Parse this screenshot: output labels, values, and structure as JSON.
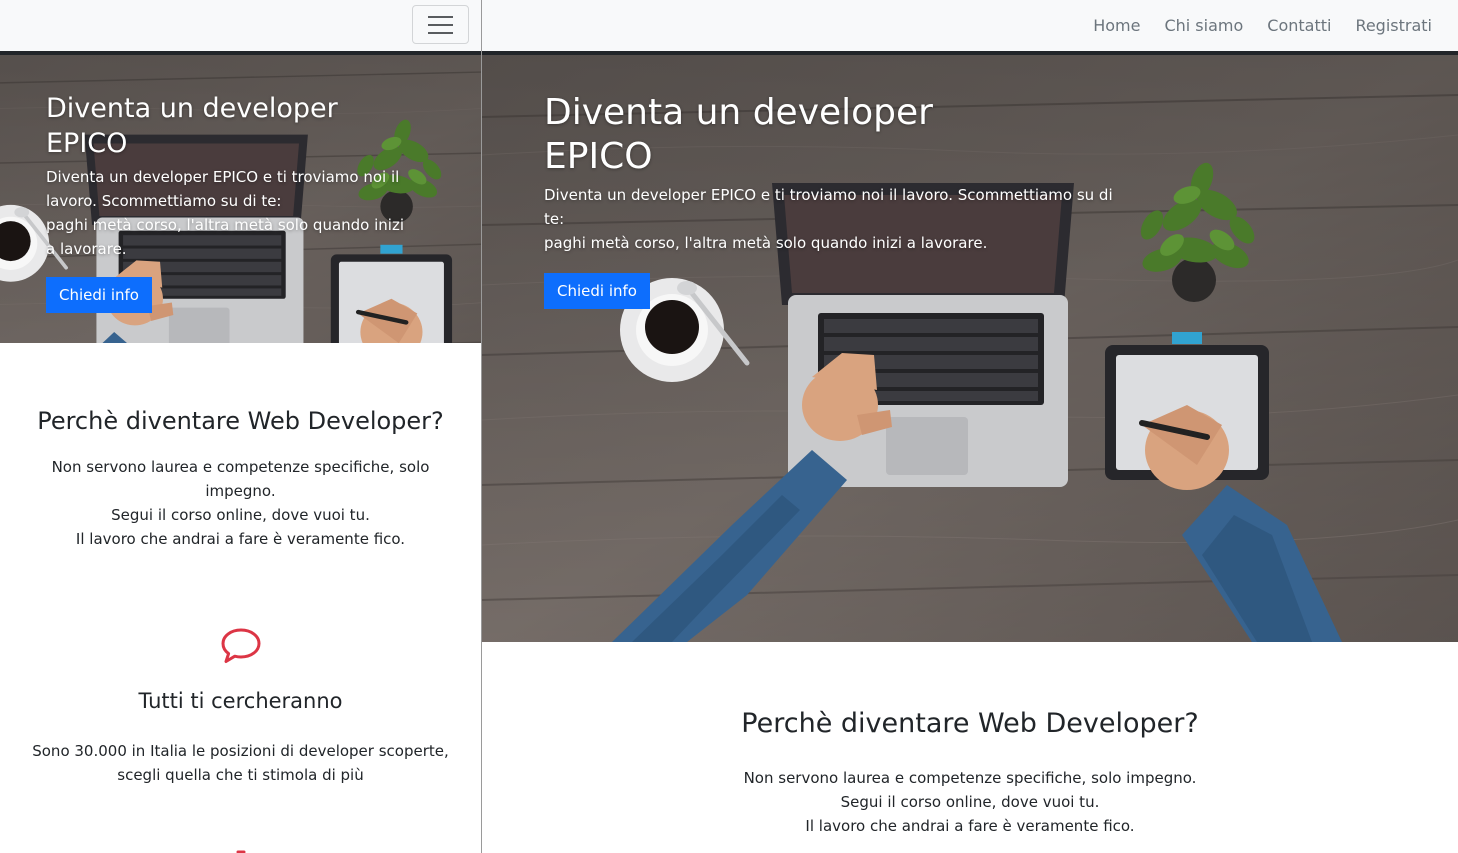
{
  "navbar": {
    "toggler_label": "Toggle navigation",
    "links": [
      "Home",
      "Chi siamo",
      "Contatti",
      "Registrati"
    ]
  },
  "hero": {
    "title_line1": "Diventa un developer",
    "title_line2": "EPICO",
    "lead_line1": "Diventa un developer EPICO e ti troviamo noi il lavoro. Scommettiamo su di te:",
    "lead_line2": "paghi metà corso, l'altra metà solo quando inizi a lavorare.",
    "button": "Chiedi info"
  },
  "why": {
    "title": "Perchè diventare Web Developer?",
    "line1": "Non servono laurea e competenze specifiche, solo impegno.",
    "line2": "Segui il corso online, dove vuoi tu.",
    "line3": "Il lavoro che andrai a fare è veramente fico."
  },
  "features": [
    {
      "icon": "chat-bubble-icon",
      "title": "Tutti ti cercheranno",
      "body": "Sono 30.000 in Italia le posizioni di developer scoperte, scegli quella che ti stimola di più"
    }
  ],
  "colors": {
    "primary": "#0d6efd",
    "navbar_bg": "#f8f9fa",
    "navbar_border": "#212529",
    "icon_red": "#dc3545",
    "nav_link": "#6c757d"
  }
}
